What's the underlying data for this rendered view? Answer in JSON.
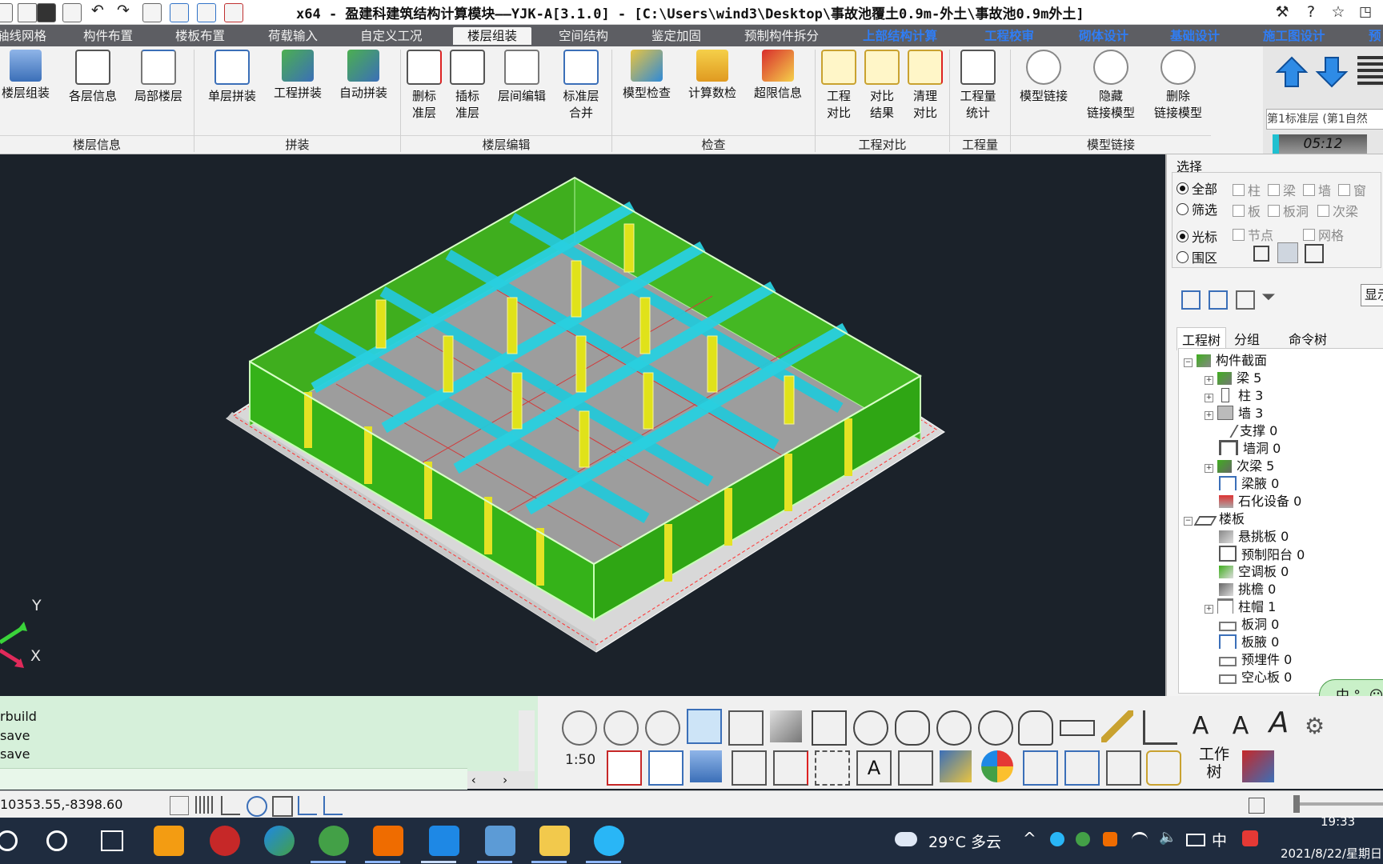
{
  "app": {
    "title": "x64 - 盈建科建筑结构计算模块——YJK-A[3.1.0] - [C:\\Users\\wind3\\Desktop\\事故池覆土0.9m-外土\\事故池0.9m外土]"
  },
  "tabs": [
    {
      "label": "轴线网格"
    },
    {
      "label": "构件布置"
    },
    {
      "label": "楼板布置"
    },
    {
      "label": "荷载输入"
    },
    {
      "label": "自定义工况"
    },
    {
      "label": "楼层组装"
    },
    {
      "label": "空间结构"
    },
    {
      "label": "鉴定加固"
    },
    {
      "label": "预制构件拆分"
    },
    {
      "label": "上部结构计算"
    },
    {
      "label": "工程校审"
    },
    {
      "label": "砌体设计"
    },
    {
      "label": "基础设计"
    },
    {
      "label": "施工图设计"
    },
    {
      "label": "预"
    }
  ],
  "ribbon": {
    "buttons": [
      {
        "label": "楼层组装"
      },
      {
        "label": "各层信息"
      },
      {
        "label": "局部楼层"
      },
      {
        "label": "单层拼装"
      },
      {
        "label": "工程拼装"
      },
      {
        "label": "自动拼装"
      },
      {
        "label": "删标准层",
        "l1": "删标",
        "l2": "准层"
      },
      {
        "label": "插标准层",
        "l1": "插标",
        "l2": "准层"
      },
      {
        "label": "层间编辑"
      },
      {
        "label": "标准层合并",
        "l1": "标准层",
        "l2": "合并"
      },
      {
        "label": "模型检查"
      },
      {
        "label": "计算数检"
      },
      {
        "label": "超限信息"
      },
      {
        "label": "工程对比",
        "l1": "工程",
        "l2": "对比"
      },
      {
        "label": "对比结果",
        "l1": "对比",
        "l2": "结果"
      },
      {
        "label": "清理对比",
        "l1": "清理",
        "l2": "对比"
      },
      {
        "label": "工程量统计",
        "l1": "工程量",
        "l2": "统计"
      },
      {
        "label": "模型链接"
      },
      {
        "label": "隐藏链接模型",
        "l1": "隐藏",
        "l2": "链接模型"
      },
      {
        "label": "删除链接模型",
        "l1": "删除",
        "l2": "链接模型"
      }
    ],
    "groups": [
      {
        "label": "楼层信息"
      },
      {
        "label": "拼装"
      },
      {
        "label": "楼层编辑"
      },
      {
        "label": "检查"
      },
      {
        "label": "工程对比"
      },
      {
        "label": "工程量"
      },
      {
        "label": "模型链接"
      }
    ],
    "floor_selector": "第1标准层 (第1自然",
    "timer": "05:12"
  },
  "side_panel": {
    "select_title": "选择",
    "mode_options": [
      {
        "label": "全部"
      },
      {
        "label": "筛选"
      }
    ],
    "pick_options": [
      {
        "label": "光标"
      },
      {
        "label": "围区"
      }
    ],
    "filter_checks": [
      {
        "label": "柱"
      },
      {
        "label": "梁"
      },
      {
        "label": "墙"
      },
      {
        "label": "窗"
      },
      {
        "label": "板"
      },
      {
        "label": "板洞"
      },
      {
        "label": "次梁"
      },
      {
        "label": "节点"
      },
      {
        "label": "网格"
      }
    ],
    "display_button": "显示",
    "tree_tabs": [
      {
        "label": "工程树"
      },
      {
        "label": "分组"
      },
      {
        "label": "命令树"
      }
    ],
    "tree": [
      {
        "label": "构件截面",
        "level": 0,
        "exp": "−"
      },
      {
        "label": "梁 5",
        "level": 1,
        "exp": "+"
      },
      {
        "label": "柱 3",
        "level": 1,
        "exp": "+"
      },
      {
        "label": "墙 3",
        "level": 1,
        "exp": "+"
      },
      {
        "label": "支撑 0",
        "level": 1,
        "exp": ""
      },
      {
        "label": "墙洞 0",
        "level": 1,
        "exp": ""
      },
      {
        "label": "次梁 5",
        "level": 1,
        "exp": "+"
      },
      {
        "label": "梁腋 0",
        "level": 1,
        "exp": ""
      },
      {
        "label": "石化设备 0",
        "level": 1,
        "exp": ""
      },
      {
        "label": "楼板",
        "level": 0,
        "exp": "−"
      },
      {
        "label": "悬挑板 0",
        "level": 1,
        "exp": ""
      },
      {
        "label": "预制阳台 0",
        "level": 1,
        "exp": ""
      },
      {
        "label": "空调板 0",
        "level": 1,
        "exp": ""
      },
      {
        "label": "挑檐 0",
        "level": 1,
        "exp": ""
      },
      {
        "label": "柱帽 1",
        "level": 1,
        "exp": "+"
      },
      {
        "label": "板洞 0",
        "level": 1,
        "exp": ""
      },
      {
        "label": "板腋 0",
        "level": 1,
        "exp": ""
      },
      {
        "label": "预埋件 0",
        "level": 1,
        "exp": ""
      },
      {
        "label": "空心板 0",
        "level": 1,
        "exp": ""
      }
    ],
    "ime_badge": "中 °, ☺"
  },
  "axes": {
    "y": "Y",
    "x": "X"
  },
  "command_lines": [
    "rbuild",
    "save",
    "save"
  ],
  "toolbar2": {
    "work_tree_l1": "工作",
    "work_tree_l2": "树",
    "scale_label": "1:50"
  },
  "status": {
    "coordinates": "10353.55,-8398.60"
  },
  "taskbar": {
    "weather": "29°C 多云",
    "ime": "中",
    "time": "19:33",
    "date": "2021/8/22/星期日"
  }
}
